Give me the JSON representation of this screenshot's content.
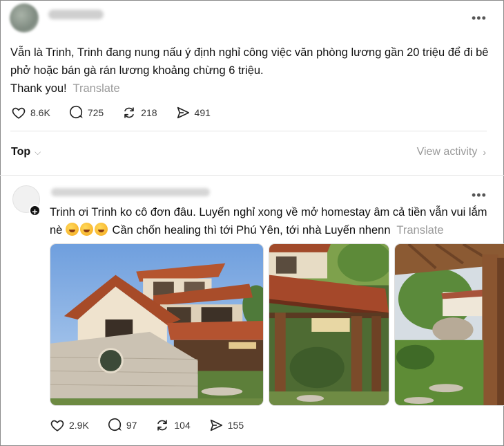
{
  "post1": {
    "text": "Vẫn là Trinh, Trinh đang nung nấu ý định nghỉ công việc văn phòng lương gần 20 triệu để đi bê phở hoặc bán gà rán lương khoảng chừng 6 triệu.",
    "text2": "Thank you!",
    "translate": "Translate",
    "likes": "8.6K",
    "comments": "725",
    "reposts": "218",
    "shares": "491"
  },
  "sort": {
    "label": "Top",
    "view_activity": "View activity"
  },
  "post2": {
    "text_a": "Trinh ơi Trinh ko cô đơn đâu. Luyến nghỉ xong về mở homestay âm cả tiền vẫn vui lắm nè",
    "text_b": "Cần chốn healing thì tới Phú Yên, tới nhà Luyến nhenn",
    "translate": "Translate",
    "emoji_count": 3,
    "emoji": "rolling-on-floor-laughing-emoji",
    "likes": "2.9K",
    "comments": "97",
    "reposts": "104",
    "shares": "155"
  },
  "icons": {
    "like": "heart-icon",
    "comment": "comment-bubble-icon",
    "repost": "repost-icon",
    "share": "share-icon",
    "more": "more-dots-icon"
  }
}
